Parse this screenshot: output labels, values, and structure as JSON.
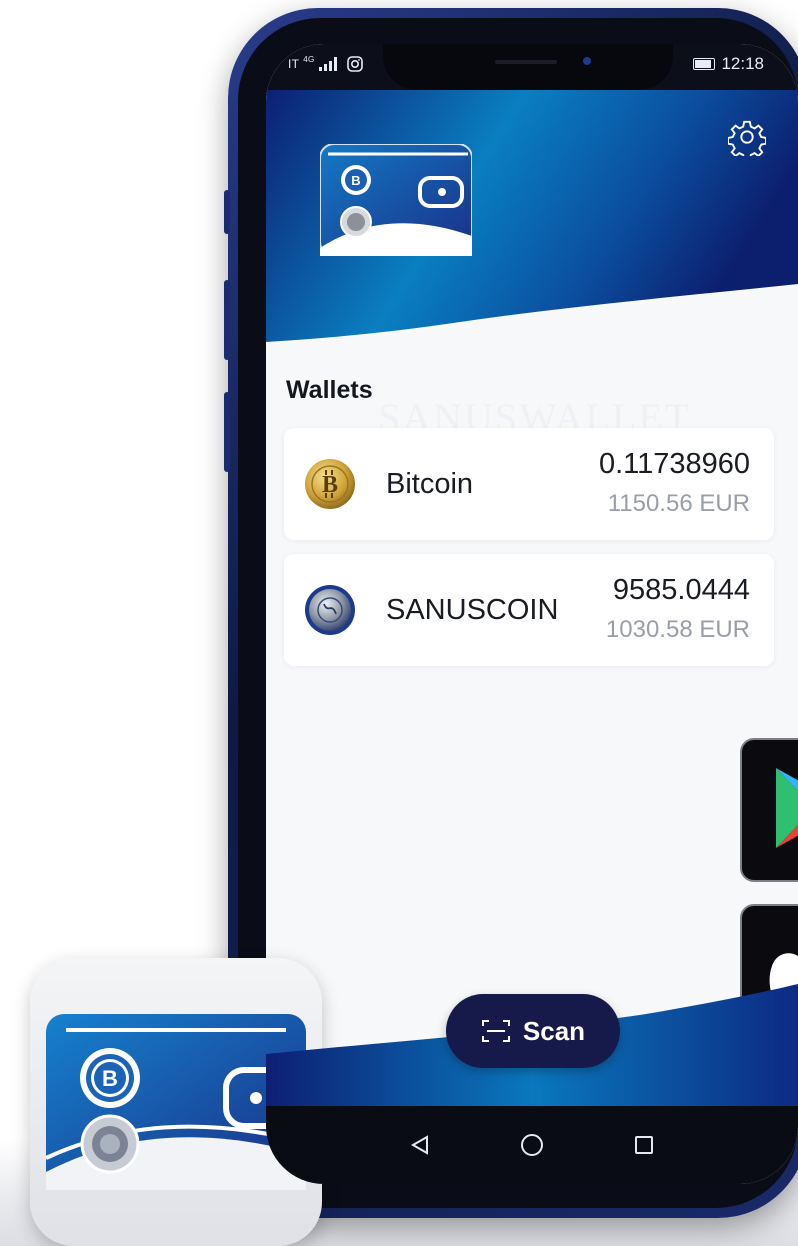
{
  "status_bar": {
    "carrier": "IT",
    "network": "4G",
    "time": "12:18"
  },
  "header": {
    "settings_icon": "gear-icon",
    "logo": "wallet-logo"
  },
  "main": {
    "section_title": "Wallets",
    "watermark": "SANUSWALLET",
    "wallets": [
      {
        "name": "Bitcoin",
        "amount": "0.11738960",
        "fiat": "1150.56 EUR",
        "icon": "bitcoin-coin-icon"
      },
      {
        "name": "SANUSCOIN",
        "amount": "9585.0444",
        "fiat": "1030.58 EUR",
        "icon": "sanuscoin-coin-icon"
      }
    ]
  },
  "scan_button": {
    "label": "Scan",
    "icon": "scan-icon"
  },
  "navbar": {
    "back": "back-triangle-icon",
    "home": "home-circle-icon",
    "recents": "recents-square-icon"
  },
  "colors": {
    "header_dark": "#0b1e6e",
    "header_light": "#0a8fc9",
    "scan_button": "#161a4a",
    "card": "#ffffff",
    "fiat_text": "#9a9ea8"
  }
}
